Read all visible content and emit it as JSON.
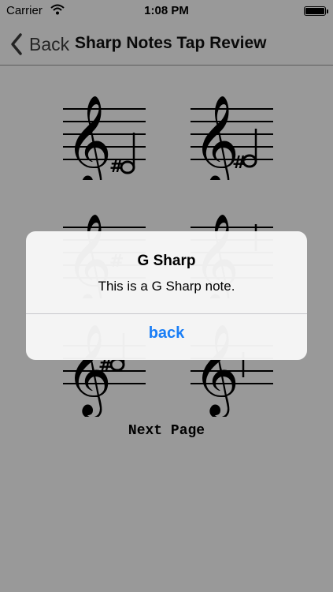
{
  "status_bar": {
    "carrier": "Carrier",
    "time": "1:08 PM",
    "wifi_icon": "wifi-icon",
    "battery_icon": "battery-icon",
    "battery_level": 1.0
  },
  "nav": {
    "back_label": "Back",
    "back_icon": "chevron-left-icon",
    "title": "Sharp Notes Tap Review"
  },
  "notes": [
    {
      "id": "note-1",
      "accidental": "#",
      "icon": "treble-clef-icon"
    },
    {
      "id": "note-2",
      "accidental": "#",
      "icon": "treble-clef-icon"
    },
    {
      "id": "note-3",
      "accidental": "#",
      "icon": "treble-clef-icon"
    },
    {
      "id": "note-4",
      "accidental": "",
      "icon": "treble-clef-icon"
    },
    {
      "id": "note-5",
      "accidental": "#",
      "icon": "treble-clef-icon"
    },
    {
      "id": "note-6",
      "accidental": "",
      "icon": "treble-clef-icon"
    }
  ],
  "next_page_label": "Next Page",
  "alert": {
    "title": "G Sharp",
    "message": "This is a G Sharp note.",
    "button_label": "back",
    "button_color": "#1a7ef6"
  },
  "colors": {
    "background": "#ffffff",
    "overlay": "#000000",
    "accent": "#1a7ef6"
  }
}
